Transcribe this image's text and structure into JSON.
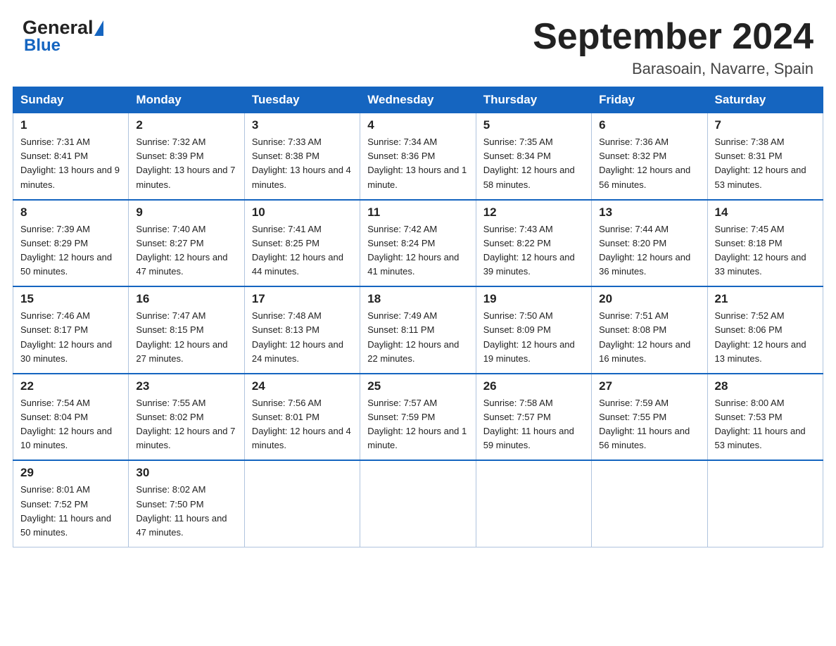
{
  "logo": {
    "general": "General",
    "blue": "Blue"
  },
  "title": {
    "main": "September 2024",
    "sub": "Barasoain, Navarre, Spain"
  },
  "headers": [
    "Sunday",
    "Monday",
    "Tuesday",
    "Wednesday",
    "Thursday",
    "Friday",
    "Saturday"
  ],
  "weeks": [
    [
      {
        "day": "1",
        "sunrise": "7:31 AM",
        "sunset": "8:41 PM",
        "daylight": "13 hours and 9 minutes."
      },
      {
        "day": "2",
        "sunrise": "7:32 AM",
        "sunset": "8:39 PM",
        "daylight": "13 hours and 7 minutes."
      },
      {
        "day": "3",
        "sunrise": "7:33 AM",
        "sunset": "8:38 PM",
        "daylight": "13 hours and 4 minutes."
      },
      {
        "day": "4",
        "sunrise": "7:34 AM",
        "sunset": "8:36 PM",
        "daylight": "13 hours and 1 minute."
      },
      {
        "day": "5",
        "sunrise": "7:35 AM",
        "sunset": "8:34 PM",
        "daylight": "12 hours and 58 minutes."
      },
      {
        "day": "6",
        "sunrise": "7:36 AM",
        "sunset": "8:32 PM",
        "daylight": "12 hours and 56 minutes."
      },
      {
        "day": "7",
        "sunrise": "7:38 AM",
        "sunset": "8:31 PM",
        "daylight": "12 hours and 53 minutes."
      }
    ],
    [
      {
        "day": "8",
        "sunrise": "7:39 AM",
        "sunset": "8:29 PM",
        "daylight": "12 hours and 50 minutes."
      },
      {
        "day": "9",
        "sunrise": "7:40 AM",
        "sunset": "8:27 PM",
        "daylight": "12 hours and 47 minutes."
      },
      {
        "day": "10",
        "sunrise": "7:41 AM",
        "sunset": "8:25 PM",
        "daylight": "12 hours and 44 minutes."
      },
      {
        "day": "11",
        "sunrise": "7:42 AM",
        "sunset": "8:24 PM",
        "daylight": "12 hours and 41 minutes."
      },
      {
        "day": "12",
        "sunrise": "7:43 AM",
        "sunset": "8:22 PM",
        "daylight": "12 hours and 39 minutes."
      },
      {
        "day": "13",
        "sunrise": "7:44 AM",
        "sunset": "8:20 PM",
        "daylight": "12 hours and 36 minutes."
      },
      {
        "day": "14",
        "sunrise": "7:45 AM",
        "sunset": "8:18 PM",
        "daylight": "12 hours and 33 minutes."
      }
    ],
    [
      {
        "day": "15",
        "sunrise": "7:46 AM",
        "sunset": "8:17 PM",
        "daylight": "12 hours and 30 minutes."
      },
      {
        "day": "16",
        "sunrise": "7:47 AM",
        "sunset": "8:15 PM",
        "daylight": "12 hours and 27 minutes."
      },
      {
        "day": "17",
        "sunrise": "7:48 AM",
        "sunset": "8:13 PM",
        "daylight": "12 hours and 24 minutes."
      },
      {
        "day": "18",
        "sunrise": "7:49 AM",
        "sunset": "8:11 PM",
        "daylight": "12 hours and 22 minutes."
      },
      {
        "day": "19",
        "sunrise": "7:50 AM",
        "sunset": "8:09 PM",
        "daylight": "12 hours and 19 minutes."
      },
      {
        "day": "20",
        "sunrise": "7:51 AM",
        "sunset": "8:08 PM",
        "daylight": "12 hours and 16 minutes."
      },
      {
        "day": "21",
        "sunrise": "7:52 AM",
        "sunset": "8:06 PM",
        "daylight": "12 hours and 13 minutes."
      }
    ],
    [
      {
        "day": "22",
        "sunrise": "7:54 AM",
        "sunset": "8:04 PM",
        "daylight": "12 hours and 10 minutes."
      },
      {
        "day": "23",
        "sunrise": "7:55 AM",
        "sunset": "8:02 PM",
        "daylight": "12 hours and 7 minutes."
      },
      {
        "day": "24",
        "sunrise": "7:56 AM",
        "sunset": "8:01 PM",
        "daylight": "12 hours and 4 minutes."
      },
      {
        "day": "25",
        "sunrise": "7:57 AM",
        "sunset": "7:59 PM",
        "daylight": "12 hours and 1 minute."
      },
      {
        "day": "26",
        "sunrise": "7:58 AM",
        "sunset": "7:57 PM",
        "daylight": "11 hours and 59 minutes."
      },
      {
        "day": "27",
        "sunrise": "7:59 AM",
        "sunset": "7:55 PM",
        "daylight": "11 hours and 56 minutes."
      },
      {
        "day": "28",
        "sunrise": "8:00 AM",
        "sunset": "7:53 PM",
        "daylight": "11 hours and 53 minutes."
      }
    ],
    [
      {
        "day": "29",
        "sunrise": "8:01 AM",
        "sunset": "7:52 PM",
        "daylight": "11 hours and 50 minutes."
      },
      {
        "day": "30",
        "sunrise": "8:02 AM",
        "sunset": "7:50 PM",
        "daylight": "11 hours and 47 minutes."
      },
      null,
      null,
      null,
      null,
      null
    ]
  ]
}
